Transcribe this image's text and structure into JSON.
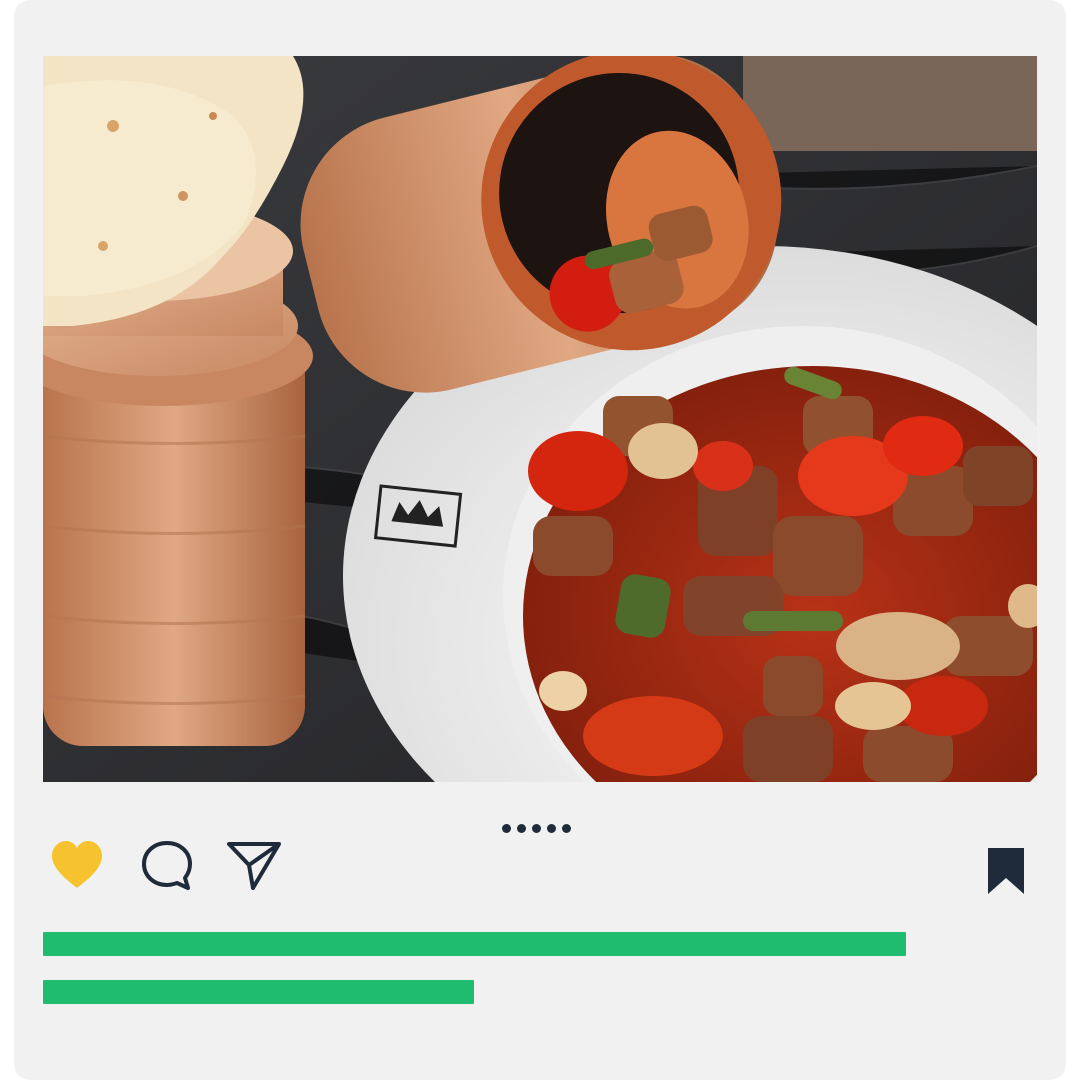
{
  "post": {
    "image": {
      "subject": "food-photo"
    },
    "carousel": {
      "dots": [
        1,
        2,
        3,
        4,
        5
      ]
    },
    "actions": {
      "like_icon": "heart-icon",
      "comment_icon": "speech-bubble-icon",
      "share_icon": "paper-plane-icon",
      "save_icon": "bookmark-icon"
    },
    "caption_placeholder_lines": [
      {
        "fill_fraction": 0.868
      },
      {
        "fill_fraction": 0.434
      }
    ]
  },
  "colors": {
    "card_background": "#f1f1f1",
    "like_heart": "#f6c22d",
    "icon_dark": "#1f2a3a",
    "caption_bar": "#1fbc6f"
  }
}
